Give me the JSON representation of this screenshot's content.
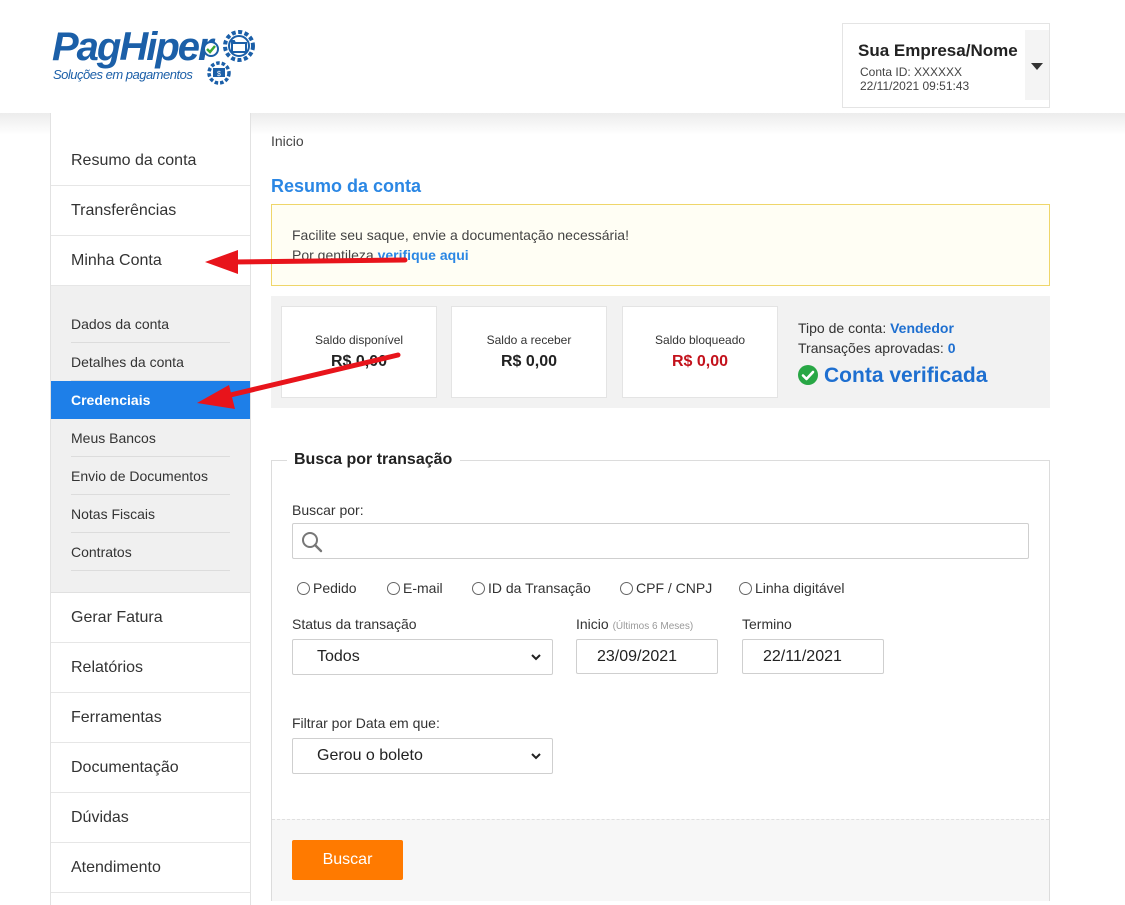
{
  "brand": {
    "name": "PagHiper",
    "tagline": "Soluções em pagamentos",
    "color": "#1b5fa8"
  },
  "account": {
    "name": "Sua Empresa/Nome",
    "id": "Conta ID: XXXXXX",
    "datetime": "22/11/2021 09:51:43"
  },
  "sidebar": {
    "items": [
      {
        "label": "Resumo da conta"
      },
      {
        "label": "Transferências"
      },
      {
        "label": "Minha Conta"
      },
      {
        "label": "Gerar Fatura"
      },
      {
        "label": "Relatórios"
      },
      {
        "label": "Ferramentas"
      },
      {
        "label": "Documentação"
      },
      {
        "label": "Dúvidas"
      },
      {
        "label": "Atendimento"
      }
    ],
    "submenu": [
      {
        "label": "Dados da conta"
      },
      {
        "label": "Detalhes da conta"
      },
      {
        "label": "Credenciais",
        "active": true
      },
      {
        "label": "Meus Bancos"
      },
      {
        "label": "Envio de Documentos"
      },
      {
        "label": "Notas Fiscais"
      },
      {
        "label": "Contratos"
      }
    ]
  },
  "breadcrumb": "Inicio",
  "page_title": "Resumo da conta",
  "alert": {
    "line1": "Facilite seu saque, envie a documentação necessária!",
    "line2_prefix": "Por gentileza ",
    "link": "verifique aqui"
  },
  "balances": [
    {
      "label": "Saldo disponível",
      "value": "R$ 0,00"
    },
    {
      "label": "Saldo a receber",
      "value": "R$ 0,00"
    },
    {
      "label": "Saldo bloqueado",
      "value": "R$ 0,00"
    }
  ],
  "account_info": {
    "type_label": "Tipo de conta: ",
    "type_value": "Vendedor",
    "approved_label": "Transações aprovadas: ",
    "approved_value": "0",
    "verified": "Conta verificada"
  },
  "search": {
    "legend": "Busca por transação",
    "search_by_label": "Buscar por:",
    "search_value": "",
    "radios": [
      "Pedido",
      "E-mail",
      "ID da Transação",
      "CPF / CNPJ",
      "Linha digitável"
    ],
    "status_label": "Status da transação",
    "status_value": "Todos",
    "start_label": "Inicio",
    "start_hint": "(Últimos 6 Meses)",
    "start_value": "23/09/2021",
    "end_label": "Termino",
    "end_value": "22/11/2021",
    "filter_label": "Filtrar por Data em que:",
    "filter_value": "Gerou o boleto",
    "button": "Buscar"
  },
  "colors": {
    "accent": "#2b87e4",
    "active_menu": "#1e7fe8",
    "button": "#ff7a00",
    "blocked": "#c3121c",
    "verified": "#1e6fd0",
    "annotation_arrow": "#e8141b"
  }
}
